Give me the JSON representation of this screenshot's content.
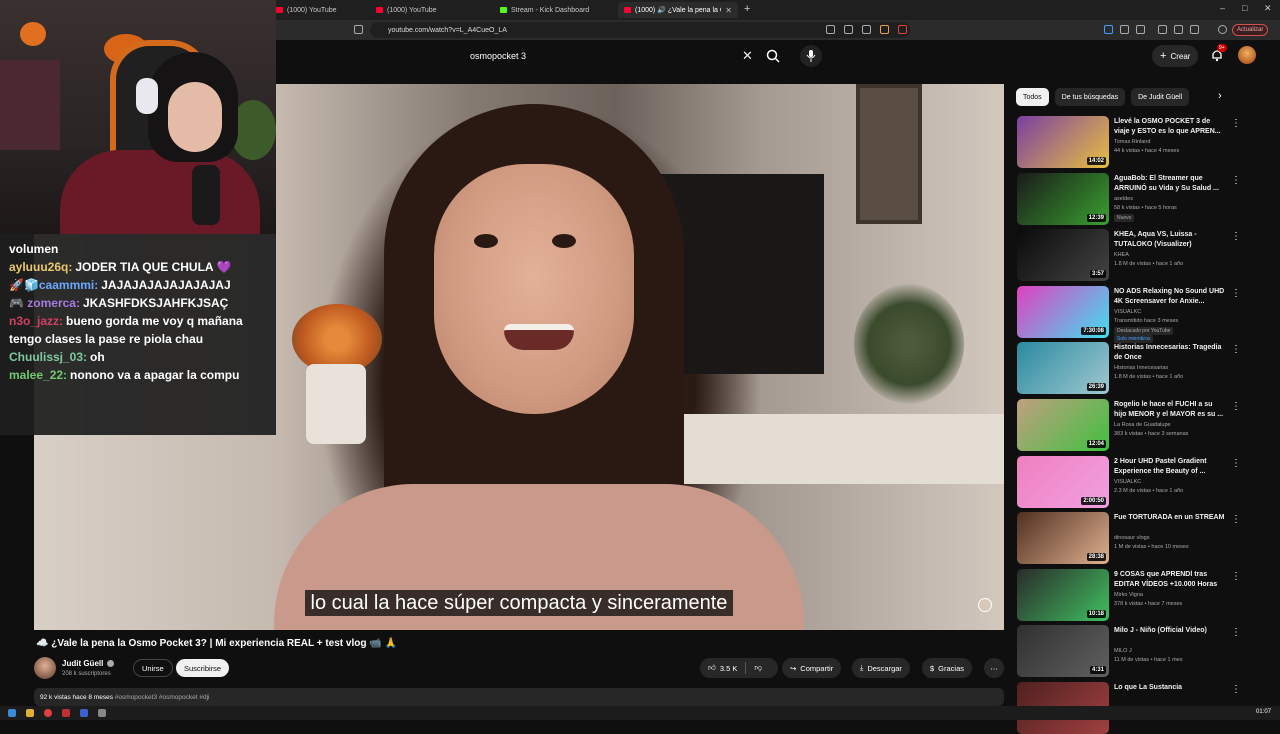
{
  "browser": {
    "tabs": [
      {
        "label": "(1000) YouTube",
        "fav_color": "#ff0033"
      },
      {
        "label": "(1000) YouTube",
        "fav_color": "#ff0033"
      },
      {
        "label": "Stream - Kick Dashboard",
        "fav_color": "#53fc18"
      },
      {
        "label": "(1000) 🔊 ¿Vale la pena la O",
        "fav_color": "#ff0033"
      }
    ],
    "url": "youtube.com/watch?v=L_A4CueO_LA",
    "update_label": "Actualizar"
  },
  "youtube": {
    "search_query": "osmopocket 3",
    "create_label": "Crear",
    "notifications_count": "9+",
    "subtitle": "lo cual la hace súper compacta y sinceramente",
    "video_title": "☁️ ¿Vale la pena la Osmo Pocket 3? | Mi experiencia REAL + test vlog 📹 🙏",
    "channel": {
      "name": "Judit Güell",
      "subscribers": "208 k suscriptores"
    },
    "join_label": "Unirse",
    "subscribe_label": "Suscribirse",
    "likes": "3.5 K",
    "share_label": "Compartir",
    "download_label": "Descargar",
    "thanks_label": "Gracias",
    "description": {
      "views_date": "92 k vistas  hace 8 meses",
      "tags": "#osmopocket3 #osmopocket #dji"
    },
    "chips": [
      "Todos",
      "De tus búsquedas",
      "De Judit Güell"
    ],
    "recommendations": [
      {
        "title": "Llevé la OSMO POCKET 3 de viaje y ESTO es lo que APREN...",
        "channel": "Tomas Rinland",
        "meta": "44 k vistas • hace 4 meses",
        "duration": "14:02",
        "thumb": [
          "#7a3fa0",
          "#e8c040"
        ],
        "badge": ""
      },
      {
        "title": "AguaBob: El Streamer que ARRUINÓ su Vida y Su Salud ...",
        "channel": "axeldes",
        "meta": "58 k vistas • hace 5 horas",
        "duration": "12:39",
        "thumb": [
          "#1a1a1a",
          "#3aa030"
        ],
        "badge": "Nuevo"
      },
      {
        "title": "KHEA, Aqua VS, Luissa - TUTALOKO (Visualizer)",
        "channel": "KHEA",
        "meta": "1.8 M de vistas • hace 1 año",
        "duration": "3:57",
        "thumb": [
          "#0a0a0a",
          "#444444"
        ],
        "badge": ""
      },
      {
        "title": "NO ADS Relaxing No Sound UHD 4K Screensaver for Anxie...",
        "channel": "VISUALKC",
        "meta": "Transmitido hace 3 meses",
        "duration": "7:30:08",
        "thumb": [
          "#e040c0",
          "#40e0f0"
        ],
        "badge": "Destacado por YouTube",
        "badge2": "Solo miembros"
      },
      {
        "title": "Historias Innecesarias: Tragedia de Once",
        "channel": "Historias Innecesarias",
        "meta": "1.8 M de vistas • hace 1 año",
        "duration": "26:39",
        "thumb": [
          "#2a8aa0",
          "#a0c8d0"
        ],
        "badge": ""
      },
      {
        "title": "Rogelio le hace el FUCHI a su hijo MENOR y el MAYOR es su ...",
        "channel": "La Rosa de Guadalupe",
        "meta": "383 k vistas • hace 3 semanas",
        "duration": "12:04",
        "thumb": [
          "#c0a080",
          "#40c040"
        ],
        "badge": ""
      },
      {
        "title": "2 Hour UHD Pastel Gradient Experience the Beauty of ...",
        "channel": "VISUALKC",
        "meta": "2.3 M de vistas • hace 1 año",
        "duration": "2:00:50",
        "thumb": [
          "#f080c0",
          "#f0a0e0"
        ],
        "badge": ""
      },
      {
        "title": "Fue TORTURADA en un STREAM",
        "channel": "dinosaur vlogs",
        "meta": "1 M de vistas • hace 10 meses",
        "duration": "28:38",
        "thumb": [
          "#503020",
          "#e0b090"
        ],
        "badge": ""
      },
      {
        "title": "9 COSAS que APRENDÍ tras EDITAR VÍDEOS +10.000 Horas",
        "channel": "Mirko Vigna",
        "meta": "378 k vistas • hace 7 meses",
        "duration": "10:18",
        "thumb": [
          "#2a2a2a",
          "#40c060"
        ],
        "badge": ""
      },
      {
        "title": "Milo J - Niño (Official Video)",
        "channel": "MILO J",
        "meta": "11 M de vistas • hace 1 mes",
        "duration": "4:31",
        "thumb": [
          "#303030",
          "#606060"
        ],
        "badge": ""
      },
      {
        "title": "Lo que La Sustancia",
        "channel": "",
        "meta": "",
        "duration": "",
        "thumb": [
          "#502020",
          "#a04040"
        ],
        "badge": ""
      }
    ]
  },
  "chat": {
    "messages": [
      {
        "user": "",
        "text": "volumen",
        "color": "#ffffff"
      },
      {
        "user": "ayluuu26q:",
        "text": "JODER TIA QUE CHULA 💜",
        "color": "#e8c870"
      },
      {
        "user": "🚀🧊caammmi:",
        "text": "JAJAJAJAJAJAJAJAJ",
        "color": "#6aa8ff"
      },
      {
        "user": "🎮 zomerca:",
        "text": "JKASHFDKSJAHFKJSAÇ",
        "color": "#a87adf"
      },
      {
        "user": "n3o_jazz:",
        "text": "bueno gorda me voy q mañana tengo clases la pase re piola chau",
        "color": "#d04060"
      },
      {
        "user": "Chuulissj_03:",
        "text": "oh",
        "color": "#80c8a0"
      },
      {
        "user": "malee_22:",
        "text": "nonono va a apagar la compu",
        "color": "#70c870"
      }
    ]
  },
  "taskbar": {
    "time": "01:07"
  }
}
